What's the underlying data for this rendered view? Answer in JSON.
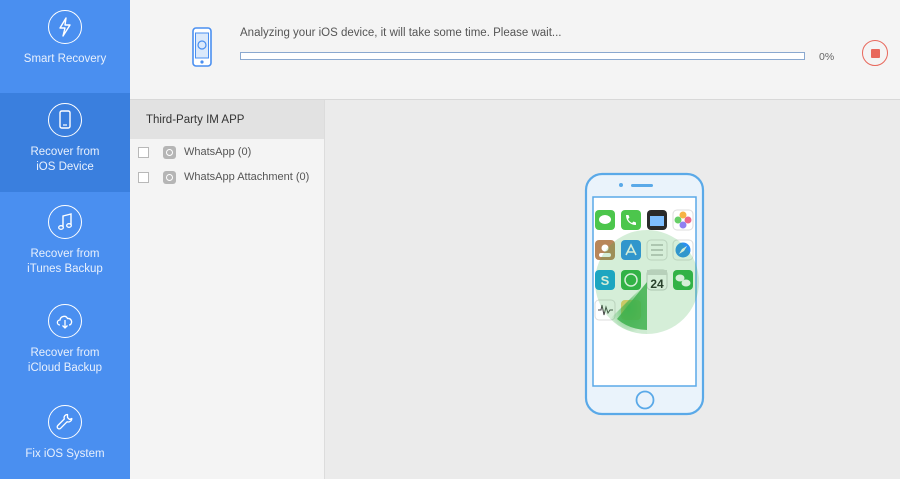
{
  "sidebar": {
    "items": [
      {
        "label": "Smart Recovery",
        "icon": "lightning-phone-icon"
      },
      {
        "label": "Recover from\niOS Device",
        "icon": "phone-restore-icon",
        "active": true
      },
      {
        "label": "Recover from\niTunes Backup",
        "icon": "music-note-icon"
      },
      {
        "label": "Recover from\niCloud Backup",
        "icon": "cloud-download-icon"
      },
      {
        "label": "Fix iOS System",
        "icon": "wrench-icon"
      }
    ]
  },
  "header": {
    "status_text": "Analyzing your iOS device, it will take some time. Please wait...",
    "progress": 0,
    "progress_label": "0%"
  },
  "categories": {
    "title": "Third-Party IM APP",
    "items": [
      {
        "label": "WhatsApp (0)"
      },
      {
        "label": "WhatsApp Attachment (0)"
      }
    ]
  },
  "phone": {
    "calendar_day": "24"
  },
  "colors": {
    "sidebar": "#4a8ff0",
    "sidebar_active": "#3a7fde",
    "progress": "#5b95e8",
    "stop": "#e8685c",
    "phone_outline": "#5aa9e8",
    "scan": "#3fb24f"
  }
}
